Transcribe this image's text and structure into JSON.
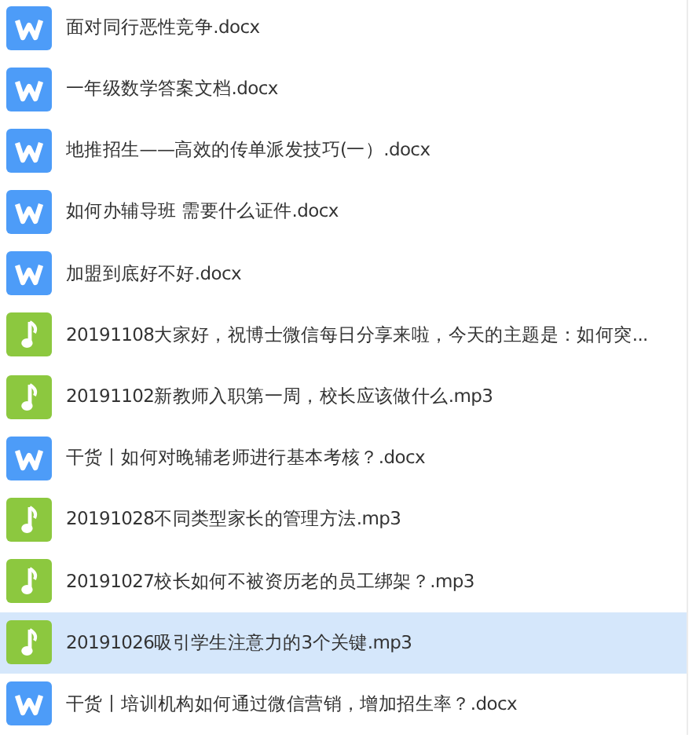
{
  "files": [
    {
      "kind": "doc",
      "name": "面对同行恶性竞争.docx",
      "selected": false
    },
    {
      "kind": "doc",
      "name": "一年级数学答案文档.docx",
      "selected": false
    },
    {
      "kind": "doc",
      "name": "地推招生——高效的传单派发技巧(一）.docx",
      "selected": false
    },
    {
      "kind": "doc",
      "name": "如何办辅导班 需要什么证件.docx",
      "selected": false
    },
    {
      "kind": "doc",
      "name": "加盟到底好不好.docx",
      "selected": false
    },
    {
      "kind": "audio",
      "name": "20191108大家好，祝博士微信每日分享来啦，今天的主题是：如何突...",
      "selected": false
    },
    {
      "kind": "audio",
      "name": "20191102新教师入职第一周，校长应该做什么.mp3",
      "selected": false
    },
    {
      "kind": "doc",
      "name": "干货丨如何对晚辅老师进行基本考核？.docx",
      "selected": false
    },
    {
      "kind": "audio",
      "name": "20191028不同类型家长的管理方法.mp3",
      "selected": false
    },
    {
      "kind": "audio",
      "name": "20191027校长如何不被资历老的员工绑架？.mp3",
      "selected": false
    },
    {
      "kind": "audio",
      "name": "20191026吸引学生注意力的3个关键.mp3",
      "selected": true
    },
    {
      "kind": "doc",
      "name": "干货丨培训机构如何通过微信营销，增加招生率？.docx",
      "selected": false
    }
  ]
}
